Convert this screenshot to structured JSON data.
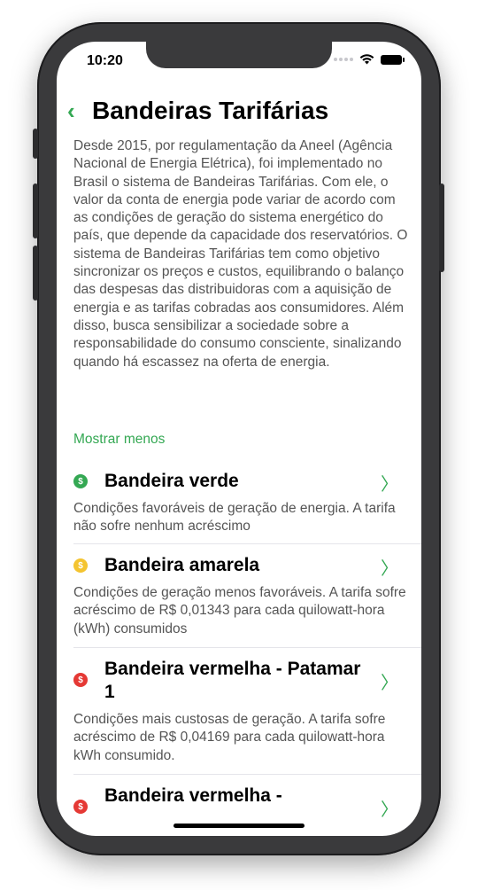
{
  "status": {
    "time": "10:20"
  },
  "header": {
    "back": "‹",
    "title": "Bandeiras Tarifárias"
  },
  "description": "Desde 2015, por regulamentação da Aneel (Agência Nacional de Energia Elétrica), foi implementado no Brasil o sistema de Bandeiras Tarifárias. Com ele, o valor da conta de energia pode variar de acordo com as condições de geração do sistema energético do país, que depende da capacidade dos reservatórios.  O sistema de Bandeiras Tarifárias tem como objetivo sincronizar os preços e custos, equilibrando o balanço das despesas das distribuidoras com a aquisição de energia e as tarifas cobradas aos consumidores. Além disso, busca sensibilizar a sociedade sobre a responsabilidade do consumo consciente, sinalizando quando há escassez na oferta de energia.",
  "show_less": "Mostrar menos",
  "items": [
    {
      "title": "Bandeira verde",
      "text": "Condições favoráveis de geração de energia. A tarifa não sofre nenhum acréscimo",
      "icon": "$",
      "color": "#34a853"
    },
    {
      "title": "Bandeira amarela",
      "text": "Condições de geração menos favoráveis. A tarifa sofre acréscimo de R$ 0,01343 para cada quilowatt-hora (kWh) consumidos",
      "icon": "$",
      "color": "#f4c430"
    },
    {
      "title": "Bandeira vermelha - Patamar 1",
      "text": "Condições mais custosas de geração. A tarifa sofre acréscimo de R$ 0,04169 para cada quilowatt-hora kWh consumido.",
      "icon": "$",
      "color": "#e53935"
    },
    {
      "title": "Bandeira vermelha -",
      "icon": "$",
      "color": "#e53935"
    }
  ],
  "chevron": "〉"
}
